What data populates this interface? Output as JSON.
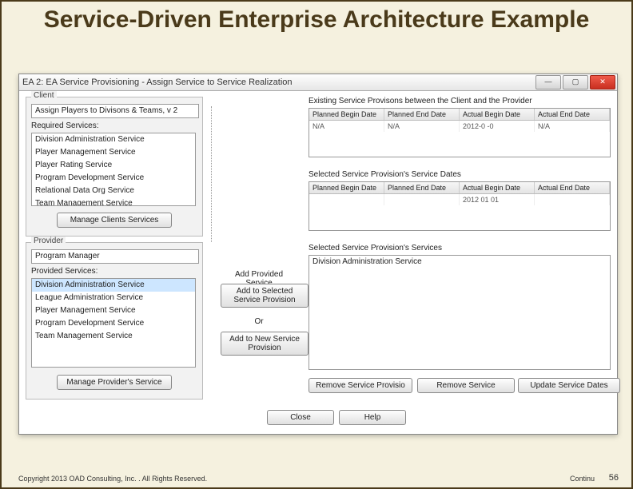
{
  "slide": {
    "title": "Service-Driven Enterprise Architecture Example",
    "footer": "Copyright 2013 OAD Consulting, Inc. . All Rights Reserved.",
    "continu": "Continu",
    "pagenum": "56"
  },
  "window": {
    "title": "EA 2: EA Service Provisioning - Assign Service to Service Realization",
    "buttons": {
      "min": "—",
      "max": "▢",
      "close": "✕"
    }
  },
  "client": {
    "label": "Client",
    "value": "Assign Players to Divisons & Teams, v 2",
    "required_label": "Required Services:",
    "services": [
      "Division Administration Service",
      "Player Management Service",
      "Player Rating Service",
      "Program Development Service",
      "Relational Data Org Service",
      "Team Management Service"
    ],
    "manage_btn": "Manage Clients Services"
  },
  "provider": {
    "label": "Provider",
    "value": "Program Manager",
    "provided_label": "Provided Services:",
    "services": [
      "Division Administration Service",
      "League Administration Service",
      "Player Management Service",
      "Program Development Service",
      "Team Management Service"
    ],
    "manage_btn": "Manage Provider's Service"
  },
  "middle": {
    "add_provided_label": "Add Provided Service",
    "add_to_selected": "Add to Selected Service Provision",
    "or_label": "Or",
    "add_to_new": "Add to New Service Provision"
  },
  "existing": {
    "label": "Existing Service Provisons between the Client and the Provider",
    "headers": [
      "Planned Begin Date",
      "Planned End Date",
      "Actual Begin Date",
      "Actual End Date"
    ],
    "row": [
      "N/A",
      "N/A",
      "2012-0 -0",
      "N/A"
    ]
  },
  "selected_dates": {
    "label": "Selected Service Provision's Service Dates",
    "headers": [
      "Planned Begin Date",
      "Planned End Date",
      "Actual Begin Date",
      "Actual End Date"
    ],
    "row": [
      "",
      "",
      "2012 01 01",
      ""
    ]
  },
  "selected_services": {
    "label": "Selected Service Provision's Services",
    "items": [
      "Division Administration Service"
    ]
  },
  "bottom": {
    "remove_provision": "Remove Service Provisio",
    "remove_service": "Remove Service",
    "update_dates": "Update Service Dates",
    "close": "Close",
    "help": "Help"
  }
}
